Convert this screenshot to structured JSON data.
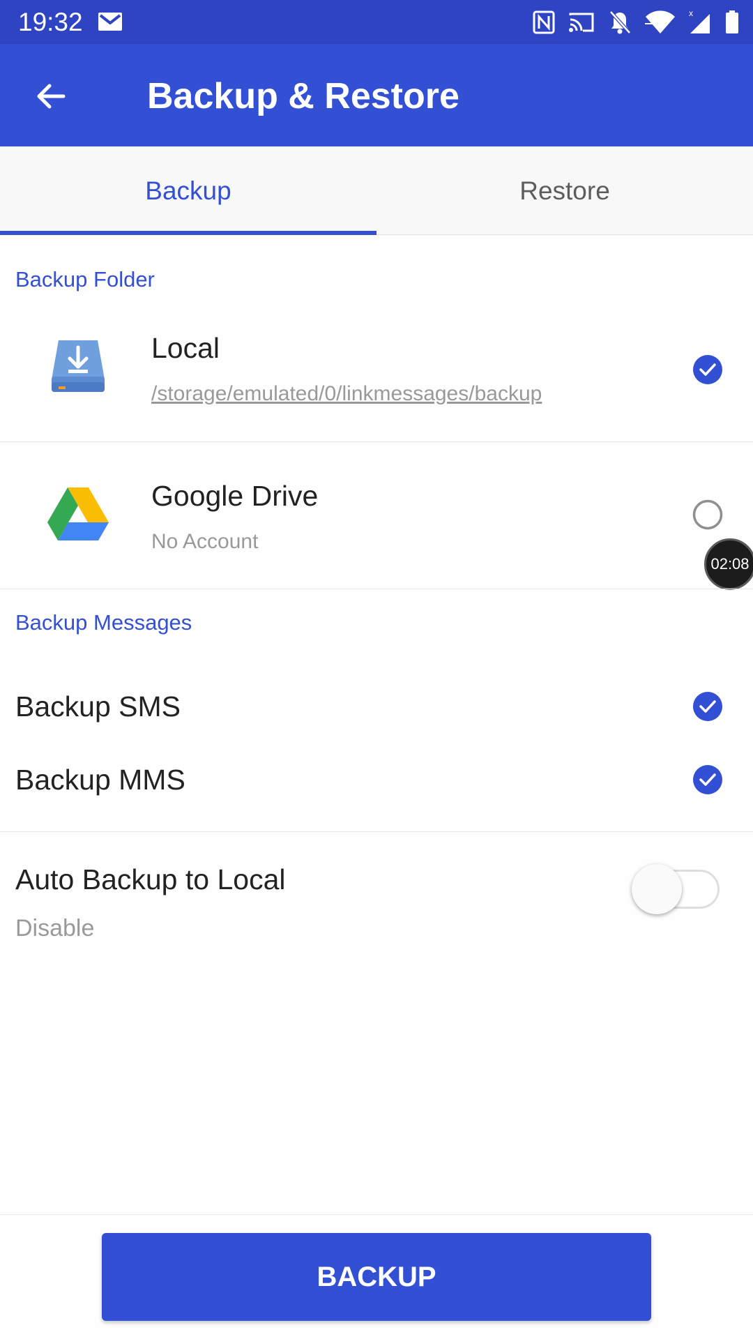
{
  "status_bar": {
    "time": "19:32",
    "icons": [
      "gmail-icon",
      "nfc-icon",
      "cast-icon",
      "notifications-off-icon",
      "wifi-icon",
      "signal-icon",
      "battery-icon"
    ]
  },
  "app_bar": {
    "title": "Backup & Restore",
    "back_icon": "arrow-back-icon"
  },
  "tabs": [
    {
      "label": "Backup",
      "selected": true
    },
    {
      "label": "Restore",
      "selected": false
    }
  ],
  "backup_folder": {
    "header": "Backup Folder",
    "options": [
      {
        "title": "Local",
        "subtitle": "/storage/emulated/0/linkmessages/backup",
        "checked": true,
        "icon": "local-storage-icon"
      },
      {
        "title": "Google Drive",
        "subtitle": "No Account",
        "checked": false,
        "icon": "google-drive-icon"
      }
    ]
  },
  "timer_badge": "02:08",
  "backup_messages": {
    "header": "Backup Messages",
    "items": [
      {
        "label": "Backup SMS",
        "checked": true
      },
      {
        "label": "Backup MMS",
        "checked": true
      }
    ]
  },
  "auto_backup": {
    "title": "Auto Backup to Local",
    "status": "Disable",
    "enabled": false
  },
  "backup_button": "BACKUP",
  "colors": {
    "primary": "#3350d4",
    "status_bar": "#2f44c2",
    "text_primary": "#222222",
    "text_secondary": "#999999"
  }
}
